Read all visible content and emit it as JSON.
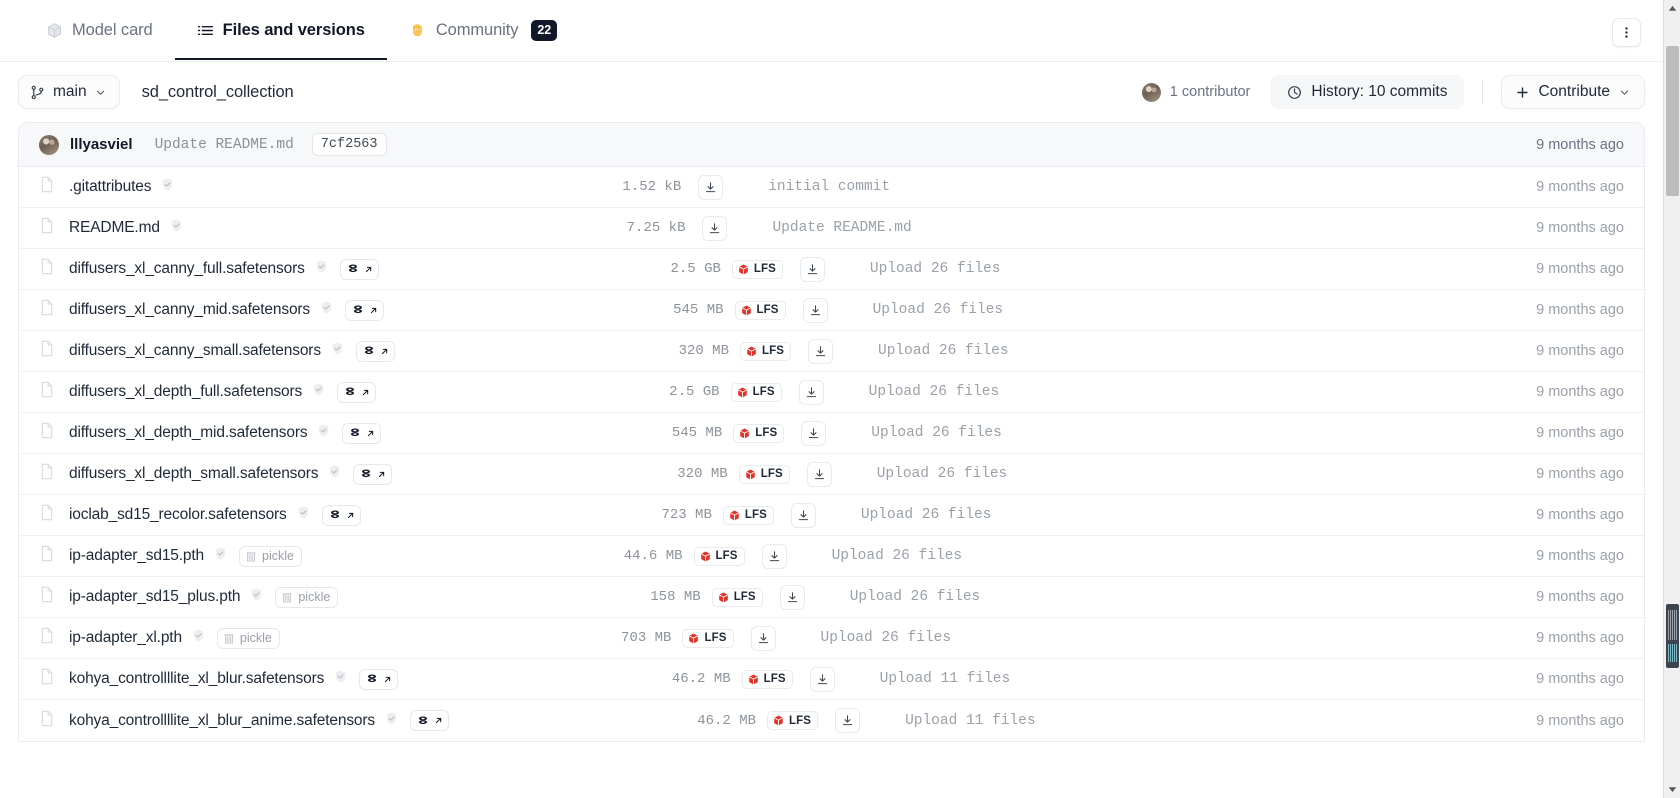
{
  "tabs": [
    {
      "label": "Model card",
      "icon": "cube-icon",
      "active": false,
      "badge": null
    },
    {
      "label": "Files and versions",
      "icon": "file-list-icon",
      "active": true,
      "badge": null
    },
    {
      "label": "Community",
      "icon": "raised-hand-emoji",
      "active": false,
      "badge": "22"
    }
  ],
  "toolbar": {
    "branch_label": "main",
    "repo_path": "sd_control_collection",
    "contributor_label": "1 contributor",
    "history_label": "History: 10 commits",
    "contribute_label": "Contribute"
  },
  "commit_header": {
    "author": "lllyasviel",
    "message": "Update README.md",
    "hash": "7cf2563",
    "time": "9 months ago"
  },
  "colors": {
    "accent_dark": "#111827",
    "lfs_red": "#e2342a",
    "muted_text": "#9ba1a9",
    "border": "#e9ebee",
    "header_bg": "#f7f8f9"
  },
  "files": [
    {
      "name": ".gitattributes",
      "badge": null,
      "size": "1.52 kB",
      "lfs": false,
      "message": "initial commit",
      "time": "9 months ago"
    },
    {
      "name": "README.md",
      "badge": null,
      "size": "7.25 kB",
      "lfs": false,
      "message": "Update README.md",
      "time": "9 months ago"
    },
    {
      "name": "diffusers_xl_canny_full.safetensors",
      "badge": "safetensors",
      "size": "2.5 GB",
      "lfs": true,
      "message": "Upload 26 files",
      "time": "9 months ago"
    },
    {
      "name": "diffusers_xl_canny_mid.safetensors",
      "badge": "safetensors",
      "size": "545 MB",
      "lfs": true,
      "message": "Upload 26 files",
      "time": "9 months ago"
    },
    {
      "name": "diffusers_xl_canny_small.safetensors",
      "badge": "safetensors",
      "size": "320 MB",
      "lfs": true,
      "message": "Upload 26 files",
      "time": "9 months ago"
    },
    {
      "name": "diffusers_xl_depth_full.safetensors",
      "badge": "safetensors",
      "size": "2.5 GB",
      "lfs": true,
      "message": "Upload 26 files",
      "time": "9 months ago"
    },
    {
      "name": "diffusers_xl_depth_mid.safetensors",
      "badge": "safetensors",
      "size": "545 MB",
      "lfs": true,
      "message": "Upload 26 files",
      "time": "9 months ago"
    },
    {
      "name": "diffusers_xl_depth_small.safetensors",
      "badge": "safetensors",
      "size": "320 MB",
      "lfs": true,
      "message": "Upload 26 files",
      "time": "9 months ago"
    },
    {
      "name": "ioclab_sd15_recolor.safetensors",
      "badge": "safetensors",
      "size": "723 MB",
      "lfs": true,
      "message": "Upload 26 files",
      "time": "9 months ago"
    },
    {
      "name": "ip-adapter_sd15.pth",
      "badge": "pickle",
      "size": "44.6 MB",
      "lfs": true,
      "message": "Upload 26 files",
      "time": "9 months ago"
    },
    {
      "name": "ip-adapter_sd15_plus.pth",
      "badge": "pickle",
      "size": "158 MB",
      "lfs": true,
      "message": "Upload 26 files",
      "time": "9 months ago"
    },
    {
      "name": "ip-adapter_xl.pth",
      "badge": "pickle",
      "size": "703 MB",
      "lfs": true,
      "message": "Upload 26 files",
      "time": "9 months ago"
    },
    {
      "name": "kohya_controllllite_xl_blur.safetensors",
      "badge": "safetensors",
      "size": "46.2 MB",
      "lfs": true,
      "message": "Upload 11 files",
      "time": "9 months ago"
    },
    {
      "name": "kohya_controllllite_xl_blur_anime.safetensors",
      "badge": "safetensors",
      "size": "46.2 MB",
      "lfs": true,
      "message": "Upload 11 files",
      "time": "9 months ago"
    }
  ],
  "pickle_badge_label": "pickle",
  "lfs_badge_label": "LFS"
}
